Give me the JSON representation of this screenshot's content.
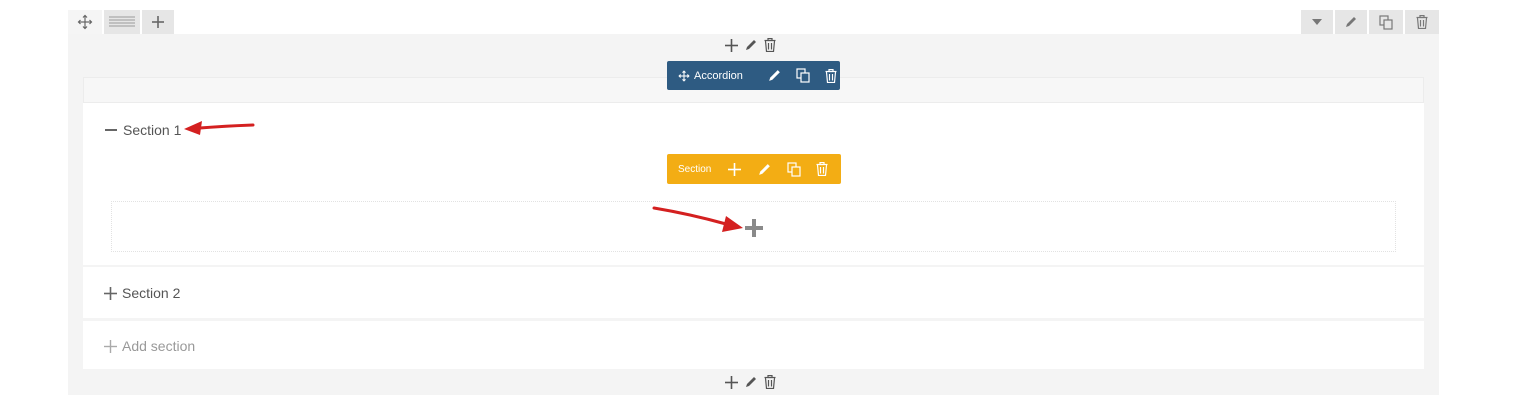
{
  "row_controls": {
    "left": [
      "move-icon",
      "columns-icon",
      "plus-icon"
    ],
    "right": [
      "caret-down-icon",
      "pencil-icon",
      "copy-icon",
      "trash-icon"
    ]
  },
  "element_controls": [
    "plus-icon",
    "pencil-icon",
    "trash-icon"
  ],
  "accordion_toolbar": {
    "label": "Accordion",
    "icons": [
      "move-icon",
      "pencil-icon",
      "copy-icon",
      "trash-icon"
    ],
    "color": "#2e5b82"
  },
  "section_toolbar": {
    "label": "Section",
    "icons": [
      "plus-icon",
      "pencil-icon",
      "copy-icon",
      "trash-icon"
    ],
    "color": "#f3ad14"
  },
  "sections": [
    {
      "title": "Section 1",
      "state": "expanded",
      "toggle_icon": "minus-icon"
    },
    {
      "title": "Section 2",
      "state": "collapsed",
      "toggle_icon": "plus-icon"
    }
  ],
  "add_section": {
    "label": "Add section",
    "icon": "plus-icon"
  },
  "annotation_arrow_color": "#d42020"
}
